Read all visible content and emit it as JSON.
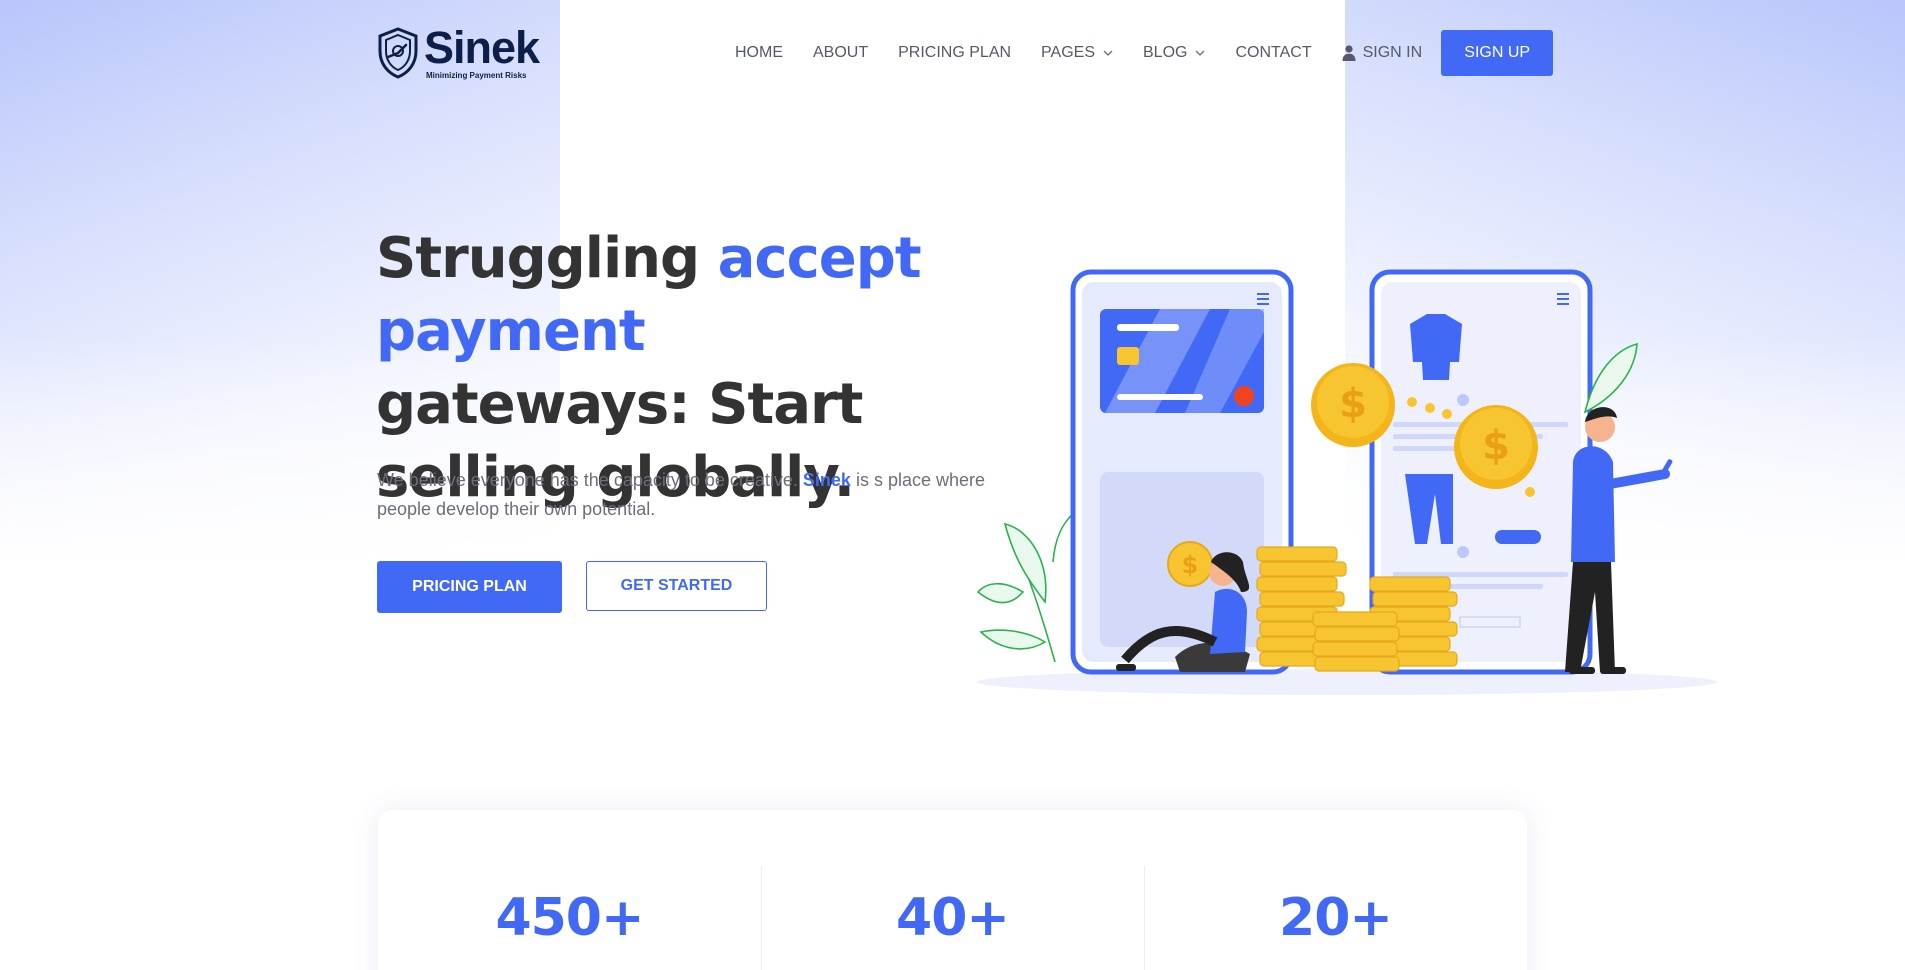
{
  "brand": {
    "name": "Sinek",
    "tagline": "Minimizing Payment Risks",
    "colors": {
      "primary": "#4169f5",
      "dark": "#0c1f4a",
      "coin": "#f7c530"
    }
  },
  "nav": {
    "items": [
      {
        "label": "HOME"
      },
      {
        "label": "ABOUT"
      },
      {
        "label": "PRICING PLAN"
      },
      {
        "label": "PAGES",
        "has_dropdown": true
      },
      {
        "label": "BLOG",
        "has_dropdown": true
      },
      {
        "label": "CONTACT"
      }
    ],
    "signin_label": "SIGN IN",
    "signin_icon": "user-icon",
    "signup_label": "SIGN UP"
  },
  "hero": {
    "title_part1": "Struggling ",
    "title_accent": "accept payment",
    "title_part2": " gateways: Start selling globally.",
    "desc_part1": "We believe everyone has the capacity to be creative. ",
    "desc_brand": "Sinek",
    "desc_part2": " is s place where people develop their own potential.",
    "primary_button": "PRICING PLAN",
    "secondary_button": "GET STARTED",
    "illustration": "payment-illustration",
    "coin_symbol": "$"
  },
  "stats": [
    {
      "value": "450+"
    },
    {
      "value": "40+"
    },
    {
      "value": "20+"
    }
  ]
}
